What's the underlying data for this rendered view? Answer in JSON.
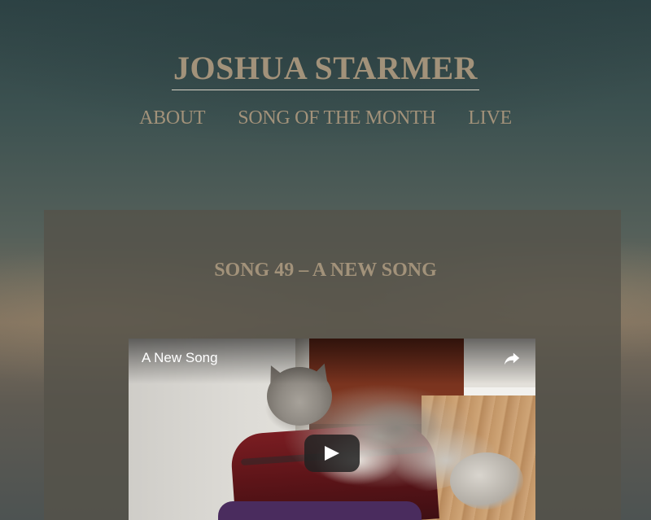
{
  "site": {
    "title": "JOSHUA STARMER"
  },
  "nav": {
    "items": [
      {
        "label": "ABOUT"
      },
      {
        "label": "SONG OF THE MONTH"
      },
      {
        "label": "LIVE"
      }
    ]
  },
  "post": {
    "title": "SONG 49 – A NEW SONG"
  },
  "video": {
    "title": "A New Song",
    "share_icon": "share-icon",
    "play_icon": "play-icon"
  },
  "colors": {
    "title_text": "#a2927a",
    "title_underline": "#d8d2c6",
    "content_panel": "#55524a",
    "play_button_bg": "#212121"
  }
}
